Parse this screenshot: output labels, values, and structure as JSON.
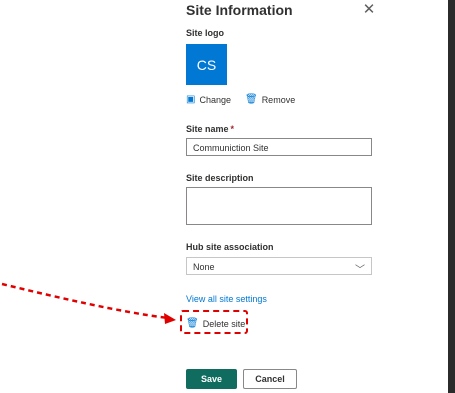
{
  "panel": {
    "title": "Site Information",
    "close_icon": "close-icon"
  },
  "site_logo": {
    "label": "Site logo",
    "initials": "CS",
    "color": "#0078d4",
    "change_label": "Change",
    "remove_label": "Remove"
  },
  "site_name": {
    "label": "Site name",
    "required_marker": "*",
    "value": "Communiction Site"
  },
  "site_description": {
    "label": "Site description",
    "value": ""
  },
  "hub_site_association": {
    "label": "Hub site association",
    "selected": "None"
  },
  "links": {
    "view_all_site_settings": "View all site settings",
    "delete_site": "Delete site"
  },
  "buttons": {
    "save": "Save",
    "cancel": "Cancel"
  },
  "annotation": {
    "color": "#e00000",
    "style": "dashed"
  }
}
